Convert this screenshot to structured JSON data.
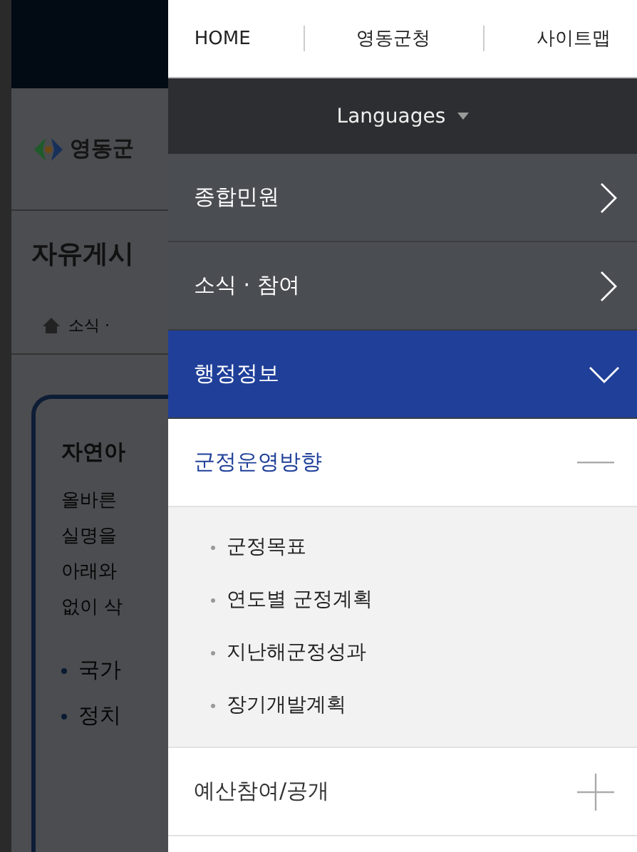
{
  "background_page": {
    "logo_text": "영동군",
    "page_title": "자유게시",
    "breadcrumb": "소식 ·",
    "card": {
      "heading": "자연아",
      "paragraph_lines": [
        "올바른",
        "실명을",
        "아래와",
        "없이 삭"
      ],
      "bullets": [
        "국가",
        "정치"
      ]
    }
  },
  "menu_panel": {
    "top_links": [
      "HOME",
      "영동군청",
      "사이트맵"
    ],
    "languages": {
      "label": "Languages"
    },
    "items": [
      {
        "label": "종합민원",
        "expanded": false
      },
      {
        "label": "소식 · 참여",
        "expanded": false
      },
      {
        "label": "행정정보",
        "expanded": true,
        "children": [
          {
            "label": "군정운영방향",
            "expanded": true,
            "children": [
              {
                "label": "군정목표"
              },
              {
                "label": "연도별 군정계획"
              },
              {
                "label": "지난해군정성과"
              },
              {
                "label": "장기개발계획"
              }
            ]
          },
          {
            "label": "예산참여/공개",
            "expanded": false
          }
        ]
      }
    ]
  }
}
